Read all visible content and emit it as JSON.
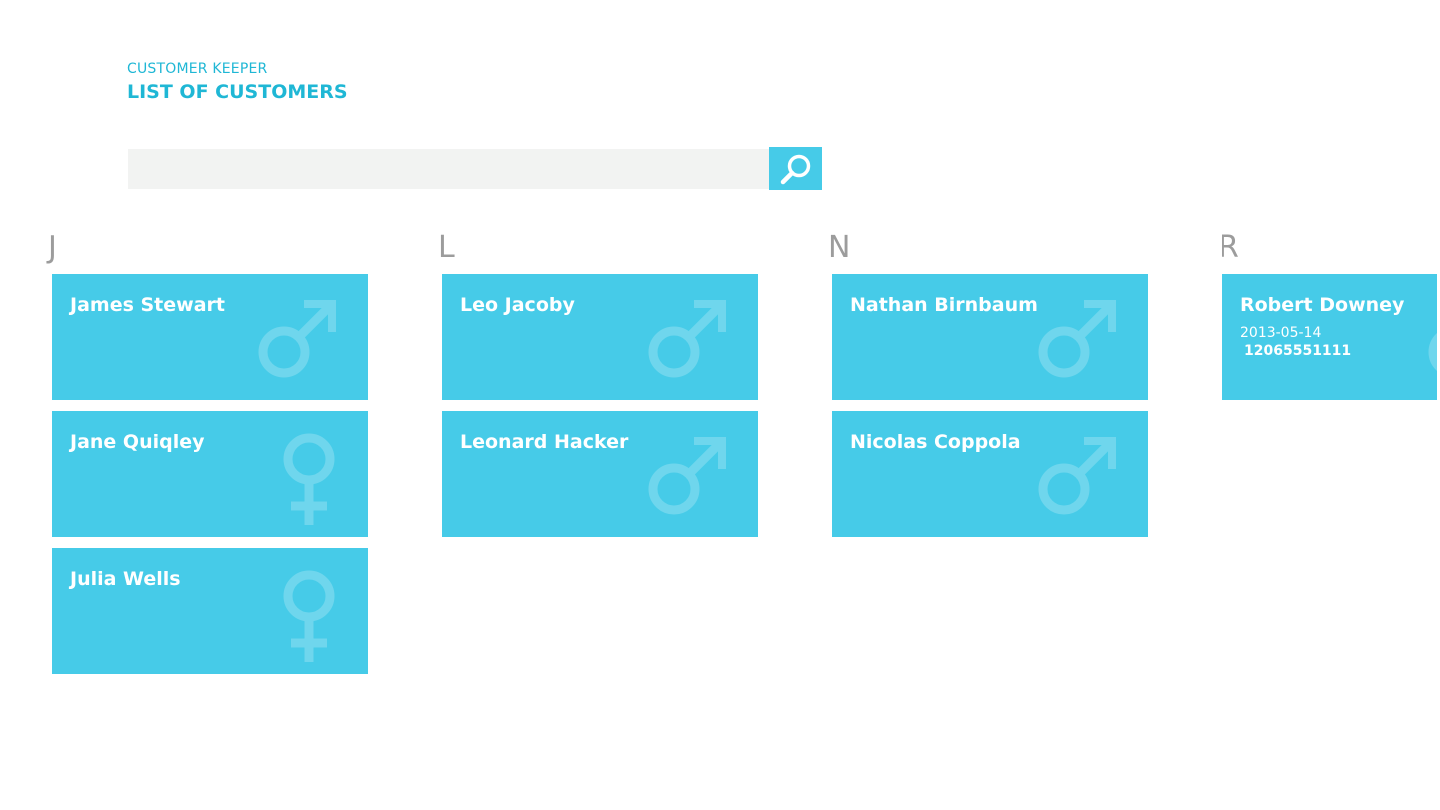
{
  "header": {
    "app_name": "CUSTOMER KEEPER",
    "page_title": "LIST OF CUSTOMERS"
  },
  "search": {
    "value": "",
    "placeholder": "",
    "button_icon": "search-icon"
  },
  "colors": {
    "accent": "#1fb7d5",
    "tile": "#46cbe8",
    "group_header": "#9c9c9c",
    "search_bg": "#f2f3f2"
  },
  "groups": [
    {
      "letter": "J",
      "customers": [
        {
          "name": "James Stewart",
          "gender": "male-icon"
        },
        {
          "name": "Jane Quiqley",
          "gender": "female-icon"
        },
        {
          "name": "Julia Wells",
          "gender": "female-icon"
        }
      ]
    },
    {
      "letter": "L",
      "customers": [
        {
          "name": "Leo Jacoby",
          "gender": "male-icon"
        },
        {
          "name": "Leonard Hacker",
          "gender": "male-icon"
        }
      ]
    },
    {
      "letter": "N",
      "customers": [
        {
          "name": "Nathan Birnbaum",
          "gender": "male-icon"
        },
        {
          "name": "Nicolas Coppola",
          "gender": "male-icon"
        }
      ]
    },
    {
      "letter": "R",
      "customers": [
        {
          "name": "Robert Downey",
          "gender": "male-icon",
          "date": "2013-05-14",
          "phone": "12065551111"
        }
      ]
    }
  ]
}
